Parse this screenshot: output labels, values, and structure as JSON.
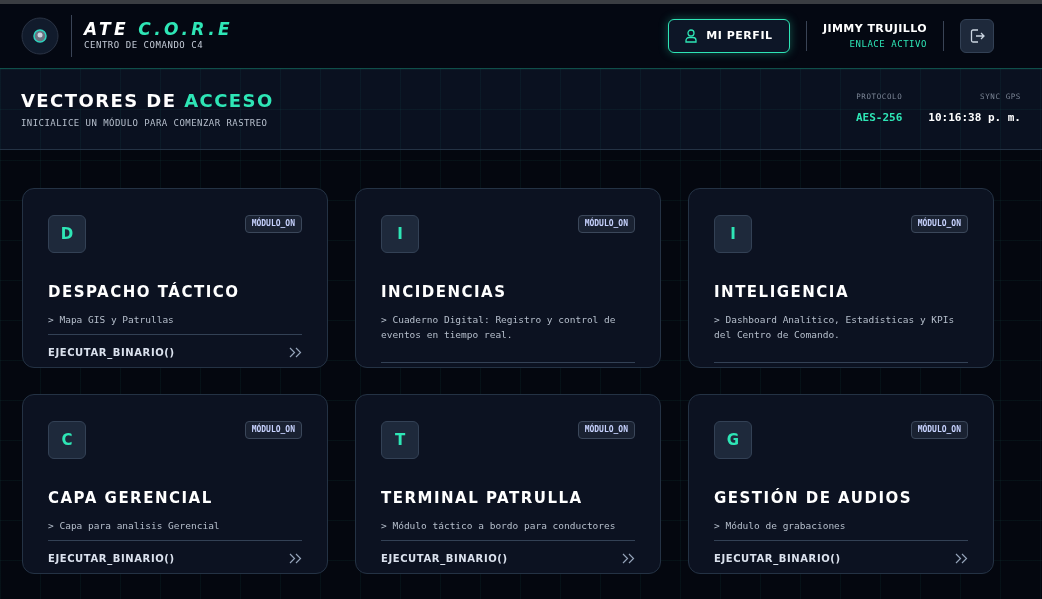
{
  "header": {
    "brand": {
      "name": "ATE",
      "name_accent": "C.O.R.E",
      "subtitle": "CENTRO DE COMANDO C4"
    },
    "profile_button": "MI PERFIL",
    "user": {
      "name": "JIMMY TRUJILLO",
      "status": "ENLACE ACTIVO"
    }
  },
  "section": {
    "title": "VECTORES DE",
    "title_accent": "ACCESO",
    "subtitle": "INICIALICE UN MÓDULO PARA COMENZAR RASTREO",
    "stats": [
      {
        "label": "PROTOCOLO",
        "value": "AES-256",
        "kind": "accent"
      },
      {
        "label": "SYNC GPS",
        "value": "10:16:38 p. m.",
        "kind": "plain"
      }
    ]
  },
  "modules": [
    {
      "initial": "D",
      "badge": "MÓDULO_ON",
      "title": "DESPACHO TÁCTICO",
      "description": "> Mapa GIS y Patrullas",
      "action": "EJECUTAR_BINARIO()"
    },
    {
      "initial": "I",
      "badge": "MÓDULO_ON",
      "title": "INCIDENCIAS",
      "description": "> Cuaderno Digital: Registro y control de eventos en tiempo real."
    },
    {
      "initial": "I",
      "badge": "MÓDULO_ON",
      "title": "INTELIGENCIA",
      "description": "> Dashboard Analítico, Estadísticas y KPIs del Centro de Comando."
    },
    {
      "initial": "C",
      "badge": "MÓDULO_ON",
      "title": "CAPA GERENCIAL",
      "description": "> Capa para analisis Gerencial",
      "action": "EJECUTAR_BINARIO()"
    },
    {
      "initial": "T",
      "badge": "MÓDULO_ON",
      "title": "TERMINAL PATRULLA",
      "description": "> Módulo táctico a bordo para conductores",
      "action": "EJECUTAR_BINARIO()"
    },
    {
      "initial": "G",
      "badge": "MÓDULO_ON",
      "title": "GESTIÓN DE AUDIOS",
      "description": "> Módulo de grabaciones",
      "action": "EJECUTAR_BINARIO()"
    }
  ]
}
